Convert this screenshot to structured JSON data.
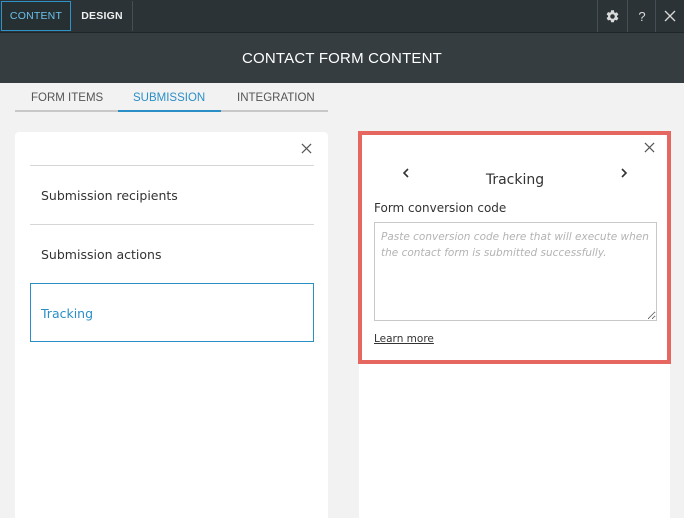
{
  "toolbar": {
    "tabs": [
      {
        "label": "CONTENT",
        "active": true
      },
      {
        "label": "DESIGN",
        "active": false
      }
    ],
    "icons": [
      "gear-icon",
      "help-icon",
      "close-icon"
    ],
    "help_label": "?"
  },
  "title": "CONTACT FORM CONTENT",
  "subtabs": [
    {
      "label": "FORM ITEMS"
    },
    {
      "label": "SUBMISSION",
      "active": true
    },
    {
      "label": "INTEGRATION"
    }
  ],
  "left_panel": {
    "items": [
      {
        "label": "Submission recipients"
      },
      {
        "label": "Submission actions"
      },
      {
        "label": "Tracking",
        "selected": true
      }
    ]
  },
  "right_panel": {
    "title": "Tracking",
    "field_label": "Form conversion code",
    "textarea_value": "",
    "textarea_placeholder": "Paste conversion code here that will execute when the contact form is submitted successfully.",
    "link_label": "Learn more"
  },
  "colors": {
    "accent": "#2a8fc7",
    "highlight": "#e5675f",
    "toolbar_bg": "#2b3336",
    "titlebar_bg": "#353d40"
  }
}
